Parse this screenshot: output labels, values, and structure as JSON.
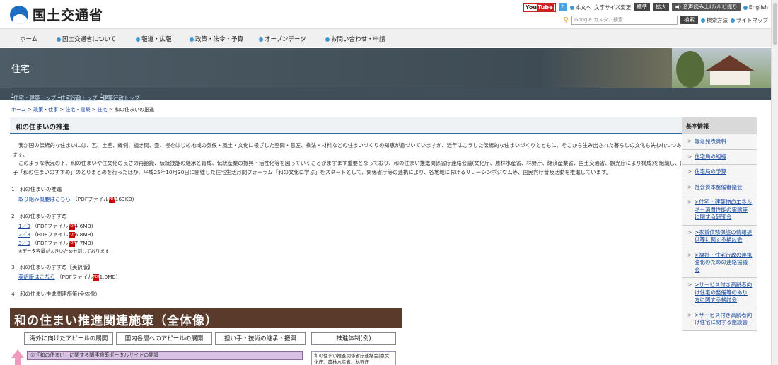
{
  "header": {
    "logo_text": "国土交通省",
    "youtube": "You",
    "youtube_tube": "Tube",
    "twitter": "t",
    "honbun": "本文へ",
    "fontsize_label": "文字サイズ変更",
    "fontsize_standard": "標準",
    "fontsize_large": "拡大",
    "speech": "音声読み上げ/ルビ振り",
    "english": "English",
    "search_placeholder": "Google カスタム検索",
    "search_button": "検索",
    "search_method": "検索方法",
    "sitemap": "サイトマップ"
  },
  "nav": [
    "ホーム",
    "国土交通省について",
    "報道・広報",
    "政策・法令・予算",
    "オープンデータ",
    "お問い合わせ・申請"
  ],
  "banner": {
    "title": "住宅"
  },
  "subnav": [
    "住宅・建築トップ",
    "住宅行政トップ",
    "建築行政トップ"
  ],
  "breadcrumb": [
    "ホーム",
    "政策・仕事",
    "住宅・建築",
    "住宅",
    "和の住まいの推進"
  ],
  "page_title": "和の住まいの推進",
  "intro": [
    "我が国の伝統的な住まいには、瓦、土壁、縁側、続き間、畳、襖をはじめ地域の気候・風土・文化に根ざした空間・意匠、構法・材料などの住まいづくりの知恵が息づいていますが、近年はこうした伝統的な住まいづくりとともに、そこから生み出された暮らしの文化も失われつつあります。",
    "このような状況の下、和の住まいや住文化の良さの再認識、伝統技能の継承と育成、伝統産業の振興・活性化等を図っていくことがますます重要となっており、和の住まい推進関係省庁連絡会議(文化庁、農林水産省、林野庁、経済産業省、国土交通省、観光庁により構成)を組織し、冊子「和の住まいのすすめ」のとりまとめを行ったほか、平成25年10月30日に開催した住宅生活月間フォーラム「和の文化に学ぶ」をスタートとして、関係省庁等の連携により、各地域におけるリレーシンポジウム等、国民向け普及活動を推進しています。"
  ],
  "sections": [
    {
      "heading": "1．和の住まいの推進",
      "links": [
        {
          "text": "取り組み概要はこちら",
          "meta": "（PDFファイル",
          "size": "163KB)"
        }
      ]
    },
    {
      "heading": "2．和の住まいのすすめ",
      "links": [
        {
          "text": "1／3",
          "meta": "（PDFファイル",
          "size": "4.6MB)"
        },
        {
          "text": "2／3",
          "meta": "（PDFファイル",
          "size": "6.8MB)"
        },
        {
          "text": "3／3",
          "meta": "（PDFファイル",
          "size": "7.7MB)"
        }
      ],
      "note": "※データ容量が大きいため分割しております"
    },
    {
      "heading": "3．和の住まいのすすめ【英訳版】",
      "links": [
        {
          "text": "英訳版はこちら",
          "meta": "（PDFファイル",
          "size": "1.0MB)"
        }
      ]
    },
    {
      "heading": "4．和の住まい推進関連施策(全体像)"
    }
  ],
  "figure": {
    "title": "和の住まい推進関連施策（全体像）",
    "cols": [
      "海外に向けたアピールの展開",
      "国内各層へのアピールの展開",
      "担い手・技術の継承・振興",
      "推進体制(例)"
    ],
    "bar": "①「和の住まい」に関する関連施策ポータルサイトの開設",
    "right": "和の住まい推進関係省庁連絡会議(文化庁、農林水産省、林野庁"
  },
  "pdf_icon": "PDF",
  "sidebar": {
    "heading": "基本情報",
    "items": [
      "報道発表資料",
      "住宅局の組織",
      "住宅局の予算",
      "社会資本整備審議会",
      ">住宅・建築物のエネルギー消費性能の実態等に関する研究会",
      ">家賃債務保証の情報提供等に関する検討会",
      ">福祉・住宅行政の連携強化のための連絡協議会",
      ">サービス付き高齢者向け住宅の整備等のあり方に関する検討会",
      ">サービス付き高齢者向け住宅に関する懇談会"
    ]
  }
}
